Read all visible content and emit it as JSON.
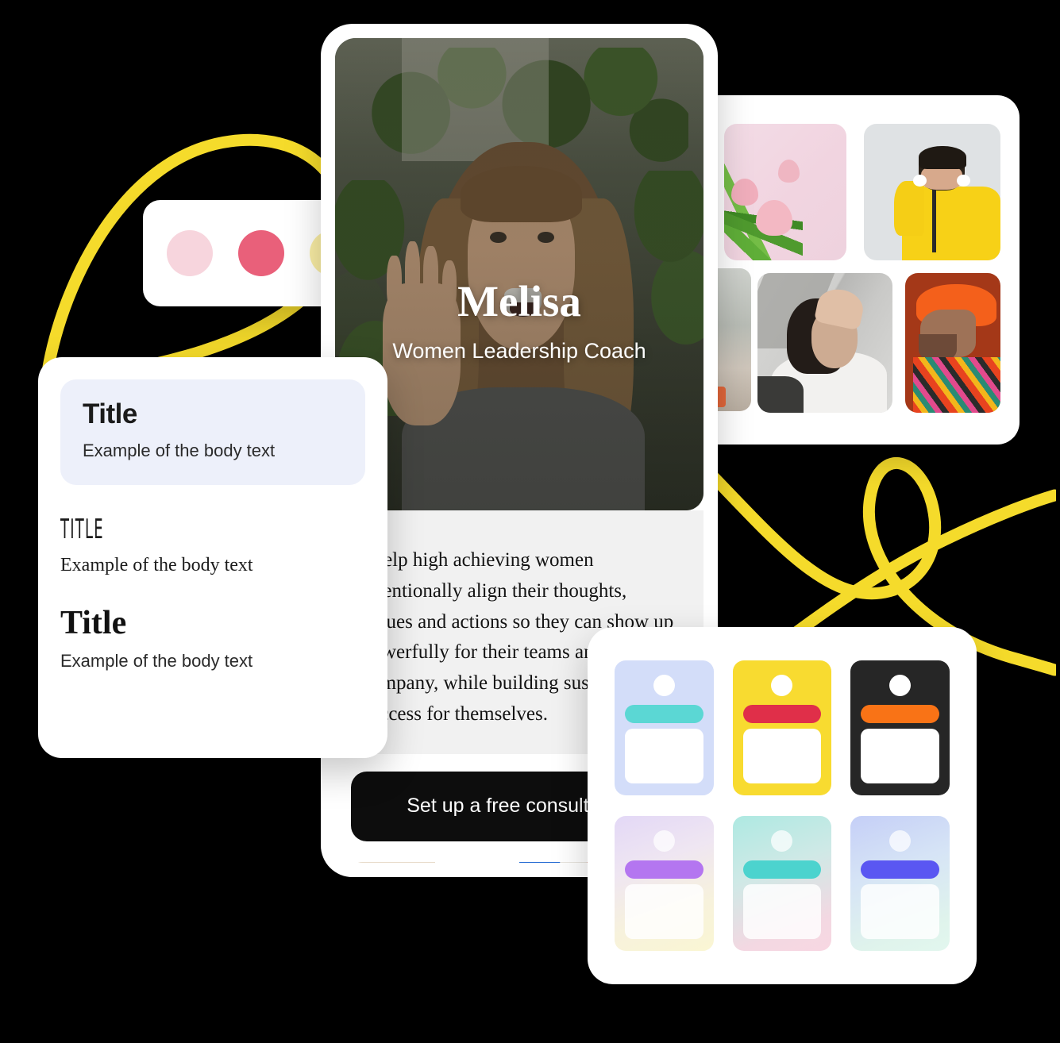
{
  "background_color": "#000000",
  "accent_yellow": "#F5DB2B",
  "palette_card": {
    "name": "color-palette-card",
    "swatches": [
      {
        "name": "light-pink",
        "hex": "#F7D5DD"
      },
      {
        "name": "rose",
        "hex": "#E9607A"
      },
      {
        "name": "pale-yellow",
        "hex": "#F9EDA4"
      }
    ]
  },
  "typography_card": {
    "samples": [
      {
        "title": "Title",
        "body": "Example of the body text",
        "style": "sans-bold",
        "highlighted": true
      },
      {
        "title": "TITLE",
        "body": "Example of the body text",
        "style": "display-condensed",
        "highlighted": false
      },
      {
        "title": "Title",
        "body": "Example of the body text",
        "style": "serif-bold",
        "highlighted": false
      }
    ],
    "highlight_color": "#EDF0FA"
  },
  "phone": {
    "hero": {
      "name": "Melisa",
      "role": "Women Leadership Coach",
      "photo_alt": "smiling woman waving with green plants behind her"
    },
    "paragraph": "I help high achieving women intentionally align their thoughts, values and actions so they can show up powerfully for their teams and company, while building sustainable success for themselves.",
    "cta_label": "Set up a free consultation",
    "cta_background": "#0D0D0D",
    "body_background": "#F1F1F1"
  },
  "photo_grid": {
    "tiles": [
      {
        "name": "tulips-on-pink",
        "alt": "pink tulips against pale pink wall"
      },
      {
        "name": "yellow-raincoat",
        "alt": "person in yellow raincoat with headphones"
      },
      {
        "name": "woman-white-shirt",
        "alt": "black and white portrait of woman in white shirt"
      },
      {
        "name": "man-orange-beanie",
        "alt": "man in orange beanie on rust background"
      },
      {
        "name": "partial-outdoor",
        "alt": "partially hidden outdoor photo"
      }
    ]
  },
  "theme_grid": {
    "tiles": [
      {
        "name": "lavender-teal",
        "bg": "#D3DDF9",
        "bar": "#5BD7D4",
        "gradient": false,
        "dim": false
      },
      {
        "name": "yellow-red",
        "bg": "#F8DB30",
        "bar": "#E02F49",
        "gradient": false,
        "dim": false
      },
      {
        "name": "black-orange",
        "bg": "#262626",
        "bar": "#F97316",
        "gradient": false,
        "dim": false
      },
      {
        "name": "purple-yellow",
        "bg": "linear-gradient(160deg,#E3D8F6 0%,#EFE6F2 35%,#F7F2DC 70%,#FAF6D3 100%)",
        "bar": "#B476F0",
        "gradient": true,
        "dim": true
      },
      {
        "name": "mint-pink",
        "bg": "linear-gradient(160deg,#AEE9E2 0%,#CFE9E6 40%,#F3D8E2 80%,#F8D7E2 100%)",
        "bar": "#4CD3CE",
        "gradient": true,
        "dim": true
      },
      {
        "name": "periwinkle-mint",
        "bg": "linear-gradient(160deg,#C5CFF7 0%,#D6E4F6 40%,#DFF3EC 80%,#E2F7EE 100%)",
        "bar": "#5A57F2",
        "gradient": true,
        "dim": true
      }
    ]
  }
}
